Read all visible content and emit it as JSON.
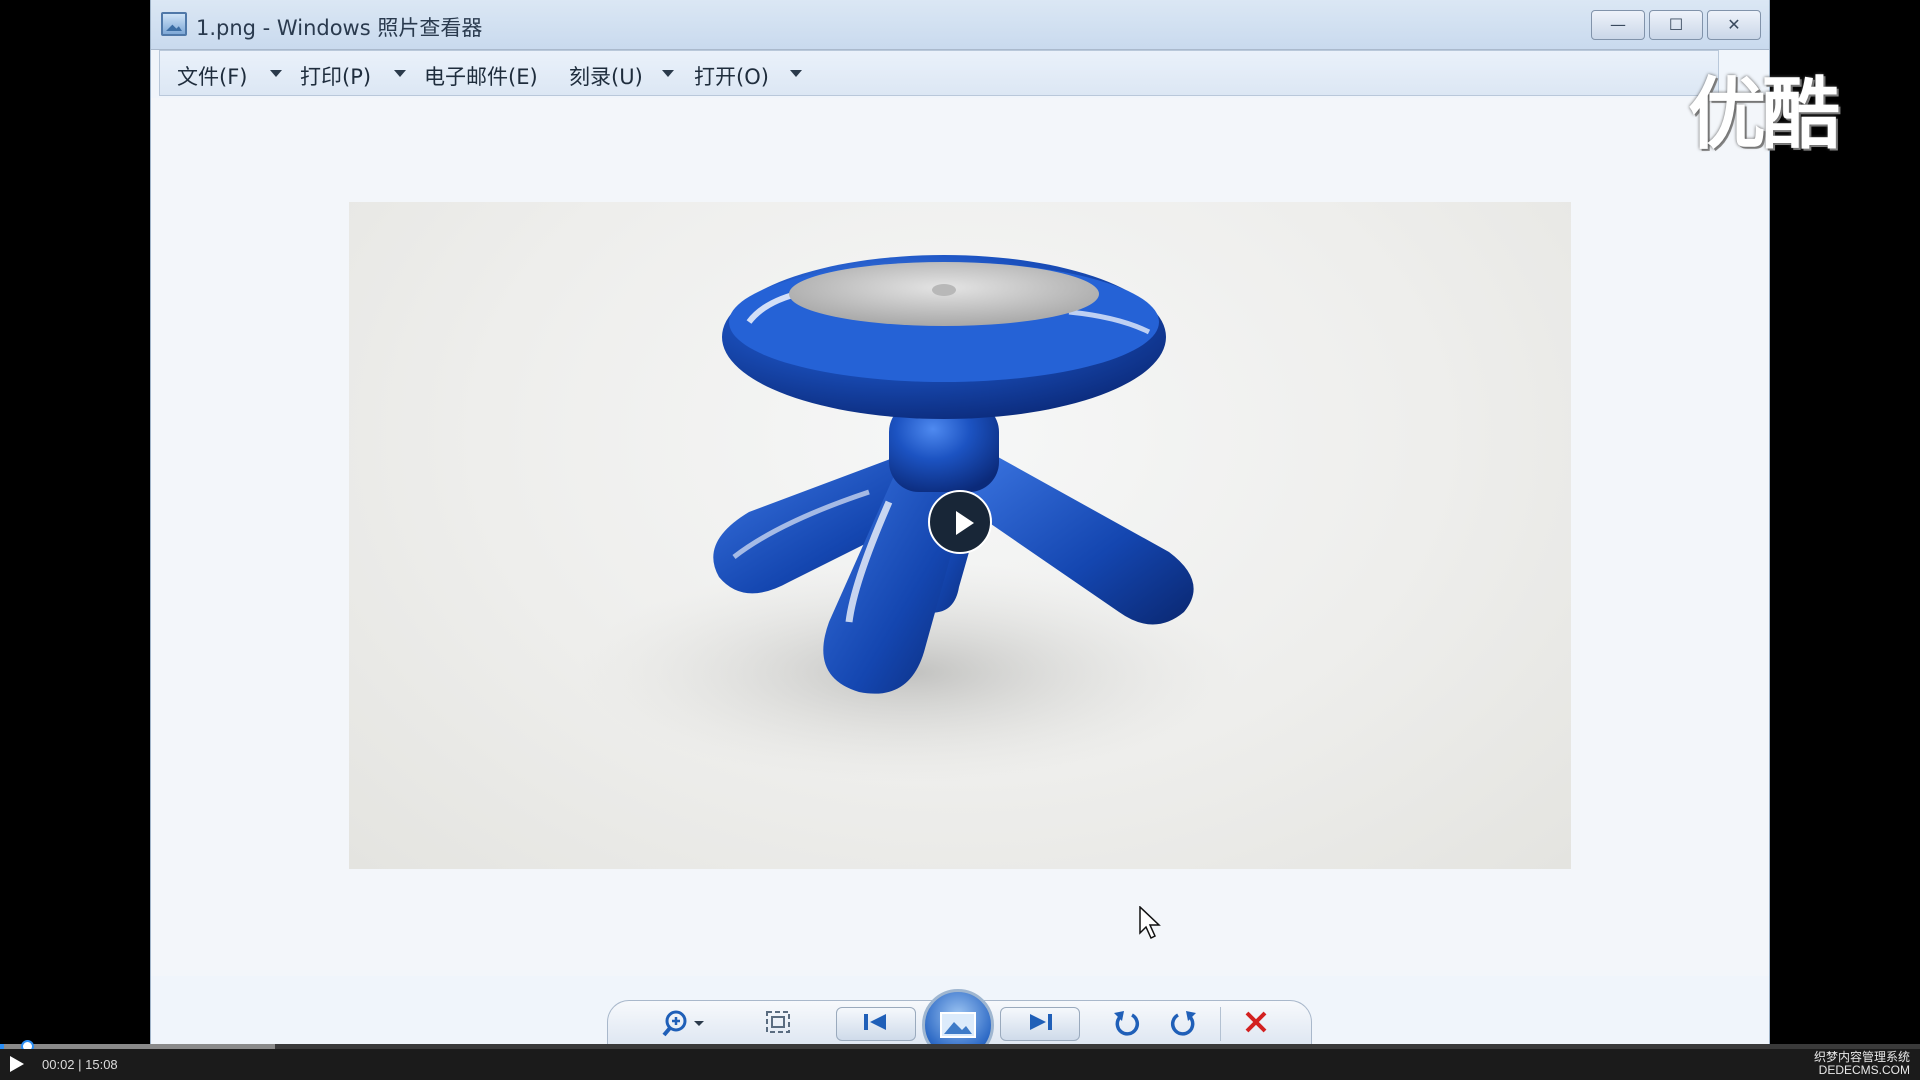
{
  "window": {
    "title": "1.png - Windows 照片查看器",
    "controls": {
      "minimize": "—",
      "maximize": "☐",
      "close": "✕"
    }
  },
  "menu": {
    "items": [
      {
        "label": "文件(F)",
        "has_dropdown": true
      },
      {
        "label": "打印(P)",
        "has_dropdown": true
      },
      {
        "label": "电子邮件(E)",
        "has_dropdown": false
      },
      {
        "label": "刻录(U)",
        "has_dropdown": true
      },
      {
        "label": "打开(O)",
        "has_dropdown": true
      }
    ]
  },
  "toolbar": {
    "zoom_icon": "zoom-icon",
    "fit_icon": "actual-size-icon",
    "prev_icon": "previous-icon",
    "slideshow_icon": "slideshow-icon",
    "next_icon": "next-icon",
    "rotate_ccw_icon": "rotate-counterclockwise-icon",
    "rotate_cw_icon": "rotate-clockwise-icon",
    "delete_icon": "delete-icon",
    "accent_blue": "#1f5fb8",
    "delete_red": "#d32020"
  },
  "watermark": {
    "text": "优酷"
  },
  "player": {
    "time": "00:02 | 15:08",
    "played_fraction": 0.0022,
    "buffered_fraction": 0.143,
    "site_logo": "织梦内容管理系统",
    "site_url": "DEDECMS.COM"
  }
}
